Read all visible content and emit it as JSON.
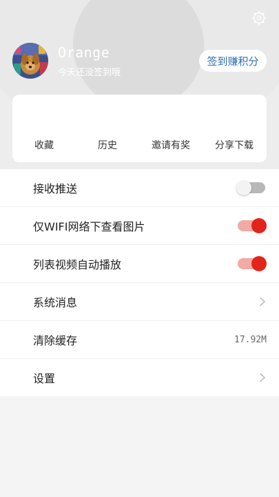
{
  "profile": {
    "username": "Orange",
    "subtitle": "今天还没签到哦",
    "signin_button": "签到赚积分"
  },
  "quick_actions": [
    {
      "label": "收藏"
    },
    {
      "label": "历史"
    },
    {
      "label": "邀请有奖"
    },
    {
      "label": "分享下载"
    }
  ],
  "settings": {
    "push": {
      "label": "接收推送",
      "enabled": false
    },
    "wifi_images": {
      "label": "仅WIFI网络下查看图片",
      "enabled": true
    },
    "autoplay": {
      "label": "列表视频自动播放",
      "enabled": true
    },
    "system_messages": {
      "label": "系统消息"
    },
    "clear_cache": {
      "label": "清除缓存",
      "value": "17.92M"
    },
    "settings": {
      "label": "设置"
    }
  },
  "colors": {
    "accent": "#e3241a",
    "accent_light": "#f2aaa4",
    "link_blue": "#2f6fb5"
  },
  "icons": {
    "settings": "gear-icon",
    "chevron": "chevron-right-icon"
  }
}
